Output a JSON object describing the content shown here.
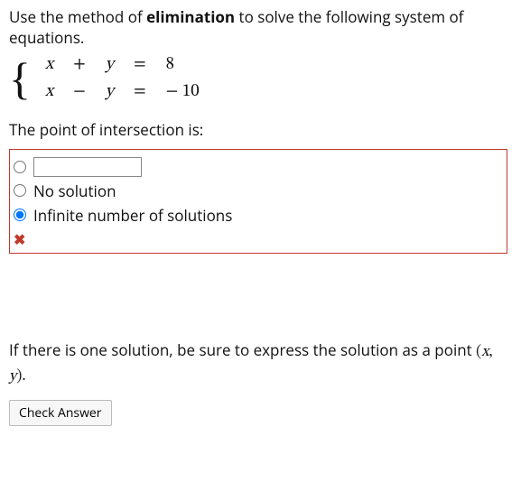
{
  "question": {
    "lead_a": "Use the method of ",
    "lead_strong": "elimination",
    "lead_b": " to solve the following system of equations."
  },
  "system": {
    "row1": {
      "x": "x",
      "op": "+",
      "y": "y",
      "eq": "=",
      "rhs": "8"
    },
    "row2": {
      "x": "x",
      "op": "−",
      "y": "y",
      "eq": "=",
      "rhs": "− 10"
    }
  },
  "sub_prompt": "The point of intersection is:",
  "options": {
    "free_value": "",
    "no_solution": "No solution",
    "infinite": "Infinite number of solutions"
  },
  "feedback": {
    "mark": "✖"
  },
  "footer": {
    "text_a": "If there is one solution, be sure to express the solution as a point ",
    "pair_open": "(",
    "pair_x": "x",
    "pair_sep": ", ",
    "pair_y": "y",
    "pair_close": ")",
    "period": "."
  },
  "buttons": {
    "check": "Check Answer"
  }
}
